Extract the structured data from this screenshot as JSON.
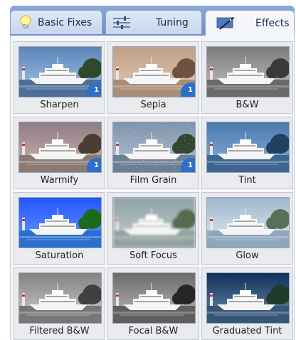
{
  "tabs": [
    {
      "label": "Basic Fixes",
      "icon": "bulb-icon"
    },
    {
      "label": "Tuning",
      "icon": "sliders-icon"
    },
    {
      "label": "Effects",
      "icon": "wand-icon",
      "active": true
    }
  ],
  "effects": [
    {
      "label": "Sharpen",
      "badge": "1"
    },
    {
      "label": "Sepia",
      "badge": "1"
    },
    {
      "label": "B&W"
    },
    {
      "label": "Warmify",
      "badge": "1"
    },
    {
      "label": "Film Grain",
      "badge": "1"
    },
    {
      "label": "Tint"
    },
    {
      "label": "Saturation"
    },
    {
      "label": "Soft Focus"
    },
    {
      "label": "Glow"
    },
    {
      "label": "Filtered B&W"
    },
    {
      "label": "Focal B&W"
    },
    {
      "label": "Graduated Tint"
    }
  ],
  "colors": {
    "tabbar": "#7c9bd0",
    "badge": "#2d6fc9",
    "panel": "#f4f6fa"
  }
}
